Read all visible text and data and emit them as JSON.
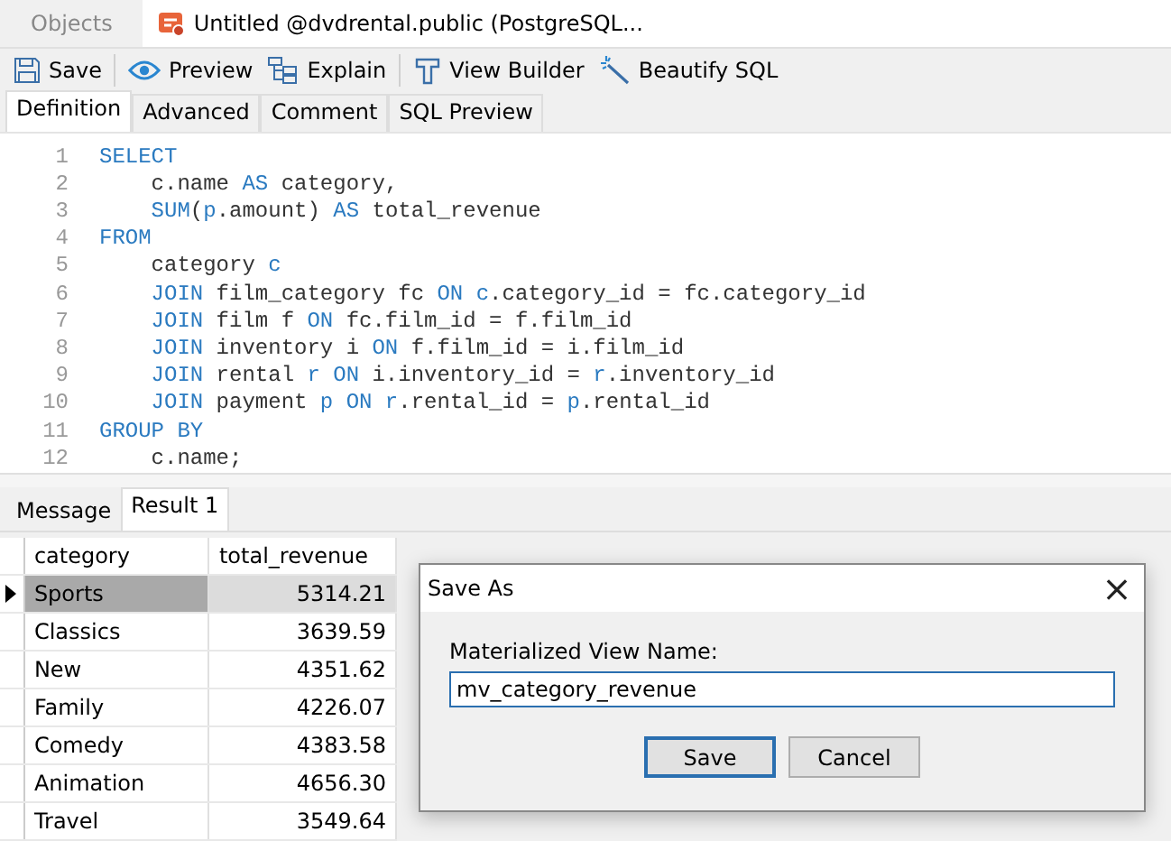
{
  "window_tabs": [
    {
      "label": "Objects",
      "selected": false,
      "kind": "plain"
    },
    {
      "label": "Untitled @dvdrental.public (PostgreSQL...",
      "selected": true,
      "kind": "query"
    }
  ],
  "toolbar": [
    {
      "label": "Save"
    },
    {
      "label": "Preview"
    },
    {
      "label": "Explain"
    },
    {
      "label": "View Builder"
    },
    {
      "label": "Beautify SQL"
    }
  ],
  "editor_tabs": [
    {
      "label": "Definition",
      "selected": true
    },
    {
      "label": "Advanced",
      "selected": false
    },
    {
      "label": "Comment",
      "selected": false
    },
    {
      "label": "SQL Preview",
      "selected": false
    }
  ],
  "editor": {
    "lines": [
      {
        "number": "1",
        "tokens": [
          {
            "text": "SELECT",
            "kind": "kw"
          }
        ]
      },
      {
        "number": "2",
        "tokens": [
          {
            "text": "    c.name ",
            "kind": "id"
          },
          {
            "text": "AS",
            "kind": "kw"
          },
          {
            "text": " category,",
            "kind": "id"
          }
        ]
      },
      {
        "number": "3",
        "tokens": [
          {
            "text": "    SUM",
            "kind": "kw"
          },
          {
            "text": "(",
            "kind": "id"
          },
          {
            "text": "p",
            "kind": "kw"
          },
          {
            "text": ".amount) ",
            "kind": "id"
          },
          {
            "text": "AS",
            "kind": "kw"
          },
          {
            "text": " total_revenue",
            "kind": "id"
          }
        ]
      },
      {
        "number": "4",
        "tokens": [
          {
            "text": "FROM",
            "kind": "kw"
          }
        ]
      },
      {
        "number": "5",
        "tokens": [
          {
            "text": "    category ",
            "kind": "id"
          },
          {
            "text": "c",
            "kind": "kw"
          }
        ]
      },
      {
        "number": "6",
        "tokens": [
          {
            "text": "    JOIN",
            "kind": "kw"
          },
          {
            "text": " film_category fc ",
            "kind": "id"
          },
          {
            "text": "ON c",
            "kind": "kw"
          },
          {
            "text": ".category_id = fc.category_id",
            "kind": "id"
          }
        ]
      },
      {
        "number": "7",
        "tokens": [
          {
            "text": "    JOIN",
            "kind": "kw"
          },
          {
            "text": " film f ",
            "kind": "id"
          },
          {
            "text": "ON",
            "kind": "kw"
          },
          {
            "text": " fc.film_id = f.film_id",
            "kind": "id"
          }
        ]
      },
      {
        "number": "8",
        "tokens": [
          {
            "text": "    JOIN",
            "kind": "kw"
          },
          {
            "text": " inventory i ",
            "kind": "id"
          },
          {
            "text": "ON",
            "kind": "kw"
          },
          {
            "text": " f.film_id = i.film_id",
            "kind": "id"
          }
        ]
      },
      {
        "number": "9",
        "tokens": [
          {
            "text": "    JOIN",
            "kind": "kw"
          },
          {
            "text": " rental ",
            "kind": "id"
          },
          {
            "text": "r ON",
            "kind": "kw"
          },
          {
            "text": " i.inventory_id = ",
            "kind": "id"
          },
          {
            "text": "r",
            "kind": "kw"
          },
          {
            "text": ".inventory_id",
            "kind": "id"
          }
        ]
      },
      {
        "number": "10",
        "tokens": [
          {
            "text": "    JOIN",
            "kind": "kw"
          },
          {
            "text": " payment ",
            "kind": "id"
          },
          {
            "text": "p ON r",
            "kind": "kw"
          },
          {
            "text": ".rental_id = ",
            "kind": "id"
          },
          {
            "text": "p",
            "kind": "kw"
          },
          {
            "text": ".rental_id",
            "kind": "id"
          }
        ]
      },
      {
        "number": "11",
        "tokens": [
          {
            "text": "GROUP BY",
            "kind": "kw"
          }
        ]
      },
      {
        "number": "12",
        "tokens": [
          {
            "text": "    c.name;",
            "kind": "id"
          }
        ]
      }
    ]
  },
  "result_tabs": [
    {
      "label": "Message",
      "selected": false
    },
    {
      "label": "Result 1",
      "selected": true
    }
  ],
  "table": {
    "columns": [
      "category",
      "total_revenue"
    ],
    "rows": [
      {
        "cells": [
          "Sports",
          "5314.21"
        ],
        "selected": true
      },
      {
        "cells": [
          "Classics",
          "3639.59"
        ],
        "selected": false
      },
      {
        "cells": [
          "New",
          "4351.62"
        ],
        "selected": false
      },
      {
        "cells": [
          "Family",
          "4226.07"
        ],
        "selected": false
      },
      {
        "cells": [
          "Comedy",
          "4383.58"
        ],
        "selected": false
      },
      {
        "cells": [
          "Animation",
          "4656.30"
        ],
        "selected": false
      },
      {
        "cells": [
          "Travel",
          "3549.64"
        ],
        "selected": false
      }
    ]
  },
  "dialog": {
    "title": "Save As",
    "close": "×",
    "label": "Materialized View Name:",
    "value": "mv_category_revenue",
    "buttons": [
      {
        "label": "Save",
        "default": true
      },
      {
        "label": "Cancel",
        "default": false
      }
    ]
  }
}
